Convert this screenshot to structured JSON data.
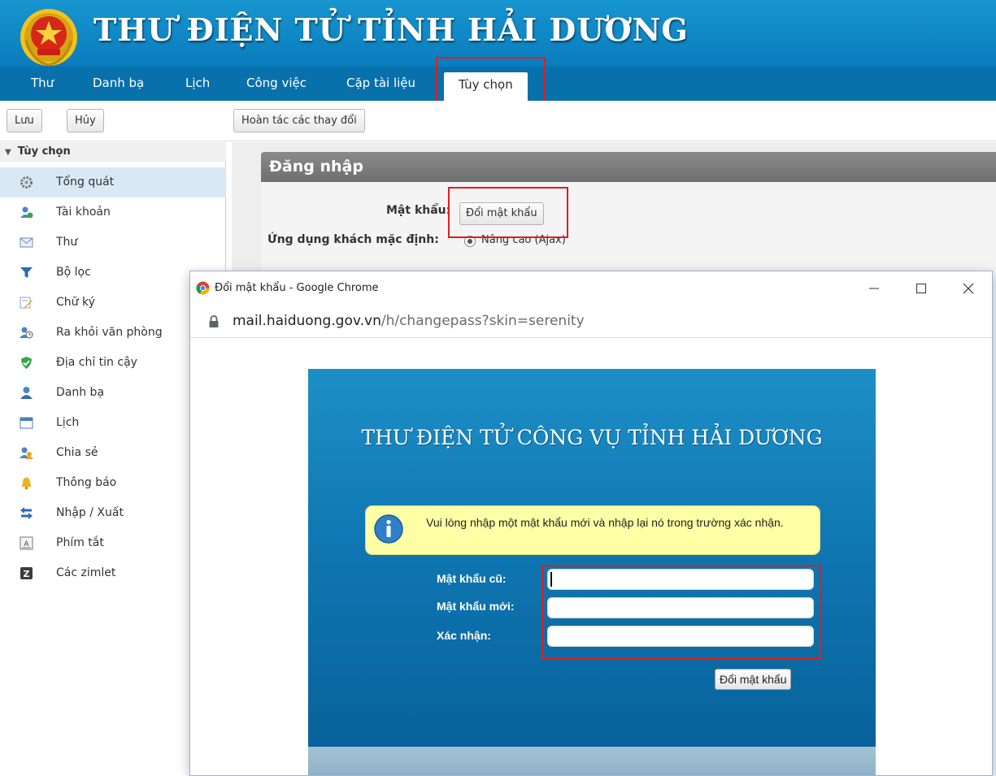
{
  "app": {
    "title": "THƯ ĐIỆN TỬ TỈNH HẢI DƯƠNG"
  },
  "nav": {
    "items": [
      "Thư",
      "Danh bạ",
      "Lịch",
      "Công việc",
      "Cặp tài liệu",
      "Tùy chọn"
    ],
    "active": "Tùy chọn"
  },
  "toolbar": {
    "save_label": "Lưu",
    "cancel_label": "Hủy",
    "undo_label": "Hoàn tác các thay đổi"
  },
  "sidebar": {
    "header": "Tùy chọn",
    "items": [
      {
        "label": "Tổng quát",
        "icon": "gear-icon"
      },
      {
        "label": "Tài khoản",
        "icon": "account-icon"
      },
      {
        "label": "Thư",
        "icon": "mail-icon"
      },
      {
        "label": "Bộ lọc",
        "icon": "filter-icon"
      },
      {
        "label": "Chữ ký",
        "icon": "signature-icon"
      },
      {
        "label": "Ra khỏi văn phòng",
        "icon": "out-of-office-icon"
      },
      {
        "label": "Địa chỉ tin cậy",
        "icon": "shield-icon"
      },
      {
        "label": "Danh bạ",
        "icon": "contact-icon"
      },
      {
        "label": "Lịch",
        "icon": "calendar-icon"
      },
      {
        "label": "Chia sẻ",
        "icon": "share-icon"
      },
      {
        "label": "Thông báo",
        "icon": "bell-icon"
      },
      {
        "label": "Nhập / Xuất",
        "icon": "import-export-icon"
      },
      {
        "label": "Phím tắt",
        "icon": "keyboard-icon"
      },
      {
        "label": "Các zimlet",
        "icon": "zimlet-icon"
      }
    ],
    "selected": "Tổng quát"
  },
  "login_section": {
    "title": "Đăng nhập",
    "password_label": "Mật khẩu:",
    "change_password_button": "Đổi mật khẩu",
    "default_client_label": "Ứng dụng khách mặc định:",
    "default_client_option": "Nâng cao (Ajax)"
  },
  "popup": {
    "window_title": "Đổi mật khẩu - Google Chrome",
    "url_host": "mail.haiduong.gov.vn",
    "url_path": "/h/changepass?skin=serenity",
    "heading": "THƯ ĐIỆN TỬ CÔNG VỤ TỈNH HẢI DƯƠNG",
    "info_message": "Vui lòng nhập một mật khẩu mới và nhập lại nó trong trường xác nhận.",
    "fields": {
      "old_password_label": "Mật khẩu cũ:",
      "new_password_label": "Mật khẩu mới:",
      "confirm_label": "Xác nhận:",
      "old_password_value": "",
      "new_password_value": "",
      "confirm_value": ""
    },
    "submit_label": "Đổi mật khẩu"
  },
  "colors": {
    "header_blue": "#0a7cbd",
    "nav_blue": "#0870ab",
    "highlight_red": "#e01e1e",
    "info_yellow": "#ffffa6"
  }
}
